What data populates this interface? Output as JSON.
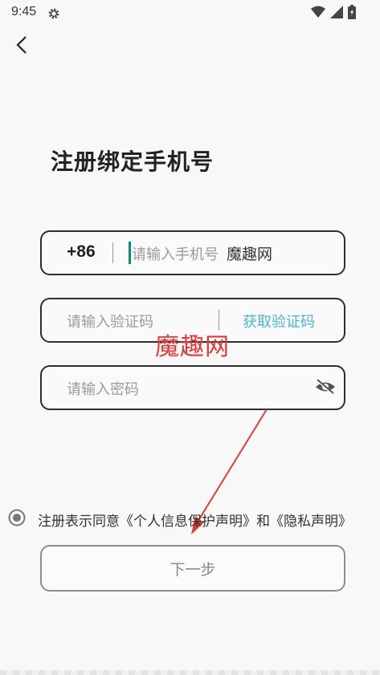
{
  "status_bar": {
    "time": "9:45"
  },
  "page": {
    "title": "注册绑定手机号"
  },
  "phone": {
    "prefix": "+86",
    "placeholder": "请输入手机号"
  },
  "code": {
    "placeholder": "请输入验证码",
    "get_code_label": "获取验证码"
  },
  "password": {
    "placeholder": "请输入密码"
  },
  "agreement": {
    "text": "注册表示同意《个人信息保护声明》和《隐私声明》"
  },
  "actions": {
    "next_label": "下一步"
  },
  "watermark": {
    "inline": "魔趣网",
    "overlay": "魔趣网"
  },
  "colors": {
    "accent_link": "#4bb5d8",
    "cursor": "#0b8a7a",
    "watermark": "#e53935"
  }
}
